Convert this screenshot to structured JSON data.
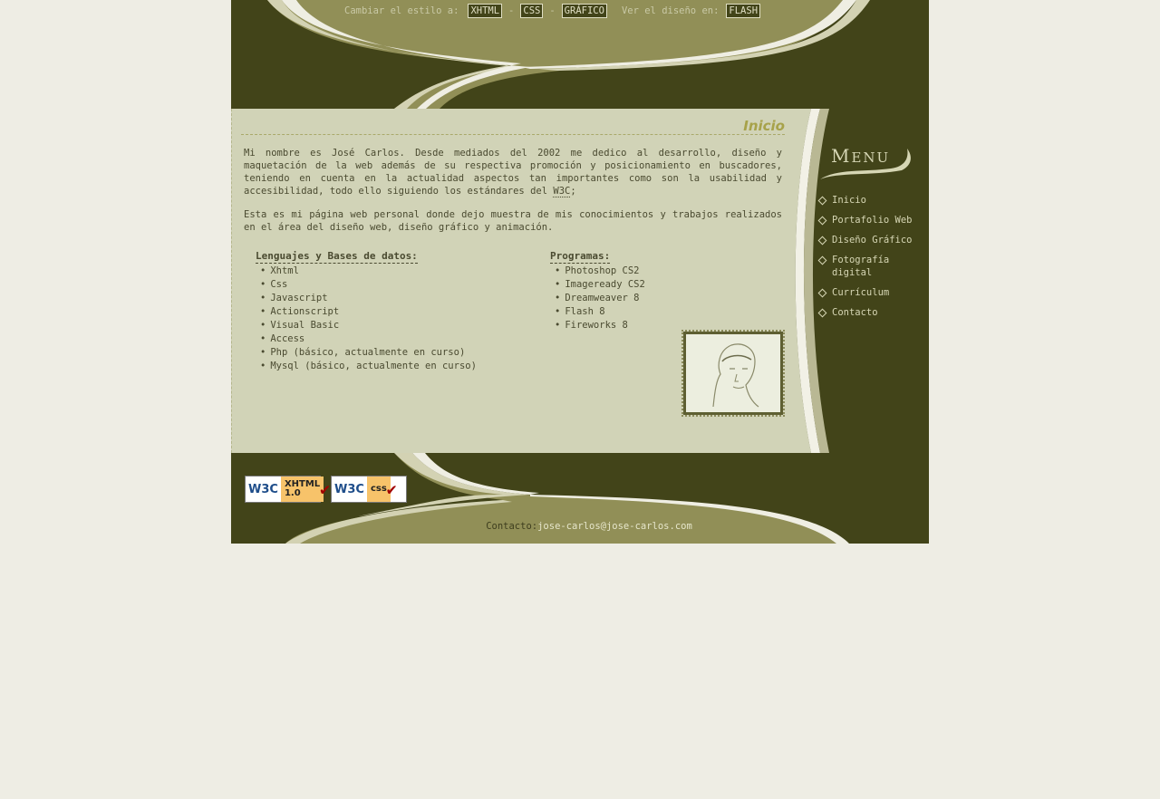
{
  "header": {
    "style_label": "Cambiar el estilo a:",
    "style_options": [
      "XHTML",
      "CSS",
      "GRÁFICO"
    ],
    "separator": "-",
    "design_label": "Ver el diseño en:",
    "design_option": "FLASH"
  },
  "content": {
    "title": "Inicio",
    "paragraph1_text": "Mi nombre es José Carlos. Desde mediados del 2002 me dedico al desarrollo, diseño y maquetación de la web además de su respectiva promoción y posicionamiento en buscadores, teniendo en cuenta en la actualidad aspectos tan importantes como son la usabilidad y accesibilidad, todo ello siguiendo los estándares del",
    "paragraph1_abbr": "W3C",
    "paragraph1_end": ";",
    "paragraph2": "Esta es mi página web personal donde dejo muestra de mis conocimientos y trabajos realizados en el área del diseño web, diseño gráfico y animación.",
    "languages": {
      "heading": "Lenguajes y Bases de datos:",
      "items": [
        "Xhtml",
        "Css",
        "Javascript",
        "Actionscript",
        "Visual Basic",
        "Access",
        "Php (básico, actualmente en curso)",
        "Mysql (básico, actualmente en curso)"
      ]
    },
    "programs": {
      "heading": "Programas:",
      "items": [
        "Photoshop CS2",
        "Imageready CS2",
        "Dreamweaver 8",
        "Flash 8",
        "Fireworks 8"
      ]
    }
  },
  "sidebar": {
    "menu_title_first": "M",
    "menu_title_rest": "ENU",
    "items": [
      "Inicio",
      "Portafolio Web",
      "Diseño Gráfico",
      "Fotografía digital",
      "Currículum",
      "Contacto"
    ]
  },
  "footer": {
    "badge_xhtml_w3c": "W3C",
    "badge_xhtml_label": "XHTML 1.0",
    "badge_css_w3c": "W3C",
    "badge_css_label": "css",
    "contact_label": "Contacto:",
    "contact_email": "jose-carlos@jose-carlos.com"
  },
  "colors": {
    "dark_olive": "#424419",
    "mid_olive": "#918f57",
    "light_beige": "#d1d3b7",
    "cream": "#d3d2b3",
    "page_bg": "#eeede4",
    "title_accent": "#a7a24a"
  }
}
